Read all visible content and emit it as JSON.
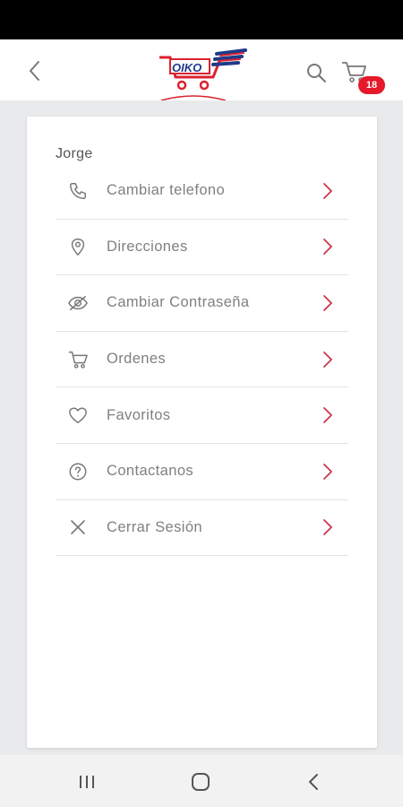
{
  "header": {
    "logo_text": "OIKO",
    "cart_count": "18"
  },
  "profile": {
    "user_name": "Jorge",
    "menu": [
      {
        "label": "Cambiar telefono",
        "icon": "phone-icon"
      },
      {
        "label": "Direcciones",
        "icon": "location-pin-icon"
      },
      {
        "label": "Cambiar Contraseña",
        "icon": "eye-slash-icon"
      },
      {
        "label": "Ordenes",
        "icon": "cart-icon"
      },
      {
        "label": "Favoritos",
        "icon": "heart-icon"
      },
      {
        "label": "Contactanos",
        "icon": "question-circle-icon"
      },
      {
        "label": "Cerrar Sesión",
        "icon": "close-icon"
      }
    ]
  },
  "colors": {
    "accent": "#c9384a",
    "badge": "#e5192b",
    "label": "#808080"
  }
}
